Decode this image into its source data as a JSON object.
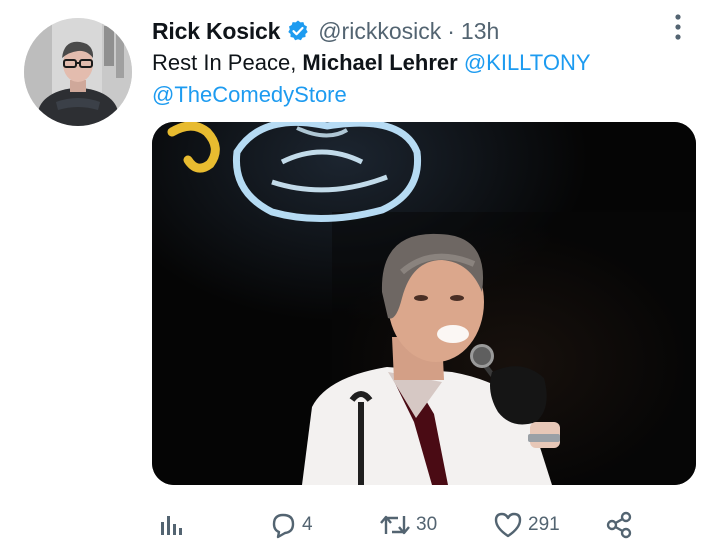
{
  "tweet": {
    "author": {
      "display_name": "Rick Kosick",
      "handle": "@rickkosick",
      "verified": true
    },
    "separator": "·",
    "time": "13h",
    "text": {
      "prefix": "Rest In Peace, ",
      "bold": "Michael Lehrer",
      "mention1": "@KILLTONY",
      "mention2": "@TheComedyStore"
    },
    "counts": {
      "replies": "4",
      "retweets": "30",
      "likes": "291"
    }
  },
  "colors": {
    "accent": "#1d9bf0",
    "muted": "#536471",
    "text": "#0f1419"
  },
  "icons": {
    "verified": "verified-badge-icon",
    "more": "more-vertical-icon",
    "analytics": "analytics-icon",
    "reply": "reply-icon",
    "retweet": "retweet-icon",
    "like": "heart-icon",
    "share": "share-icon"
  }
}
